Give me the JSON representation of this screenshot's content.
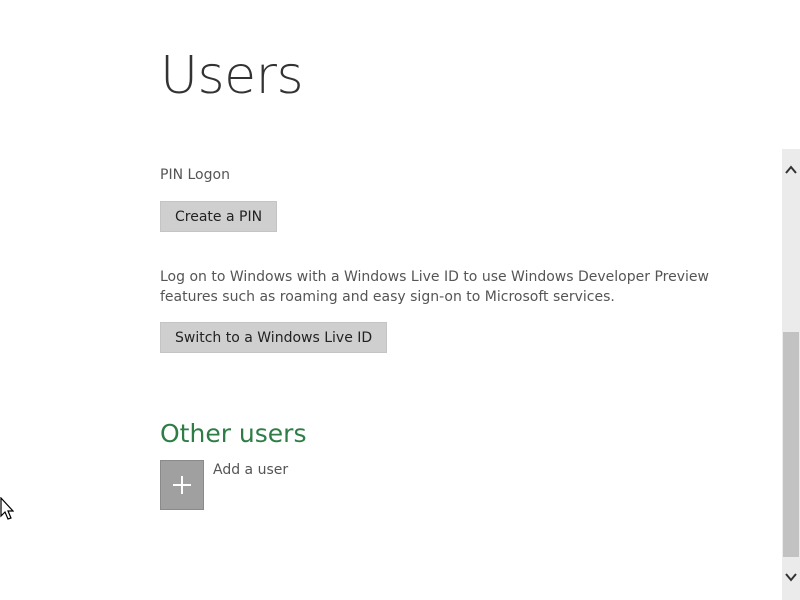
{
  "page": {
    "title": "Users"
  },
  "pin": {
    "label": "PIN Logon",
    "button_label": "Create a PIN"
  },
  "live_id": {
    "description": "Log on to Windows with a Windows Live ID to use Windows Developer Preview features such as roaming and easy sign-on to Microsoft services.",
    "button_label": "Switch to a Windows Live ID"
  },
  "other_users": {
    "heading": "Other users",
    "add_icon": "plus-icon",
    "add_label": "Add a user"
  },
  "colors": {
    "heading_green": "#2e7d46",
    "button_gray": "#cfcfcf",
    "tile_gray": "#a0a0a0"
  },
  "scrollbar": {
    "up_icon": "chevron-up-icon",
    "down_icon": "chevron-down-icon"
  }
}
